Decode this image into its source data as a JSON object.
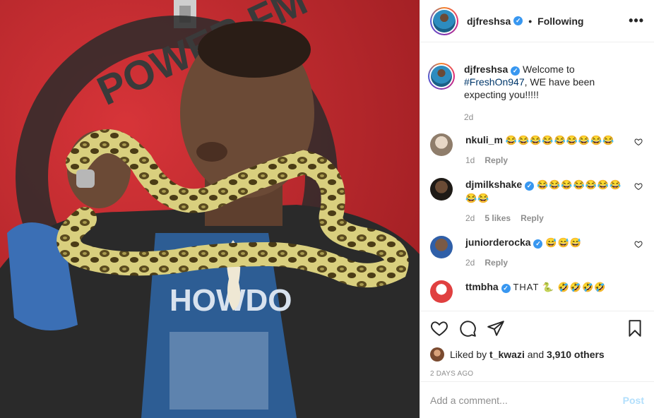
{
  "post": {
    "username": "djfreshsa",
    "follow_dot": "•",
    "follow_status": "Following",
    "more_label": "•••"
  },
  "photo": {
    "sign_letters": "POWER FM",
    "shirt_text": "HOWDO"
  },
  "caption": {
    "username": "djfreshsa",
    "text_before": "Welcome to ",
    "hashtag": "#FreshOn947",
    "text_after": ", WE have been expecting you!!!!!",
    "time": "2d"
  },
  "comments": [
    {
      "username": "nkuli_m",
      "verified": false,
      "text": "😂😂😂😂😂😂😂😂😂",
      "time": "1d",
      "likes": "",
      "reply": "Reply",
      "avatar_color": "#c9b9a8"
    },
    {
      "username": "djmilkshake",
      "verified": true,
      "text": "😂😂😂😂😂😂😂😂😂",
      "time": "2d",
      "likes": "5 likes",
      "reply": "Reply",
      "avatar_color": "#3a2f25"
    },
    {
      "username": "juniorderocka",
      "verified": true,
      "text": "😅😅😅",
      "time": "2d",
      "likes": "",
      "reply": "Reply",
      "avatar_color": "#2f5fa8"
    },
    {
      "username": "ttmbha",
      "verified": true,
      "text": "THAT 🐍 🤣🤣🤣🤣",
      "time": "",
      "likes": "",
      "reply": "",
      "avatar_color": "#e04040"
    }
  ],
  "likes": {
    "prefix": "Liked by ",
    "user": "t_kwazi",
    "middle": " and ",
    "count": "3,910 others"
  },
  "time_ago": "2 DAYS AGO",
  "add_comment": {
    "placeholder": "Add a comment...",
    "post_label": "Post"
  },
  "colors": {
    "verified": "#3897f0",
    "post_disabled": "#b2dffc",
    "hashtag": "#00376b",
    "wall_red": "#c62a2f"
  }
}
